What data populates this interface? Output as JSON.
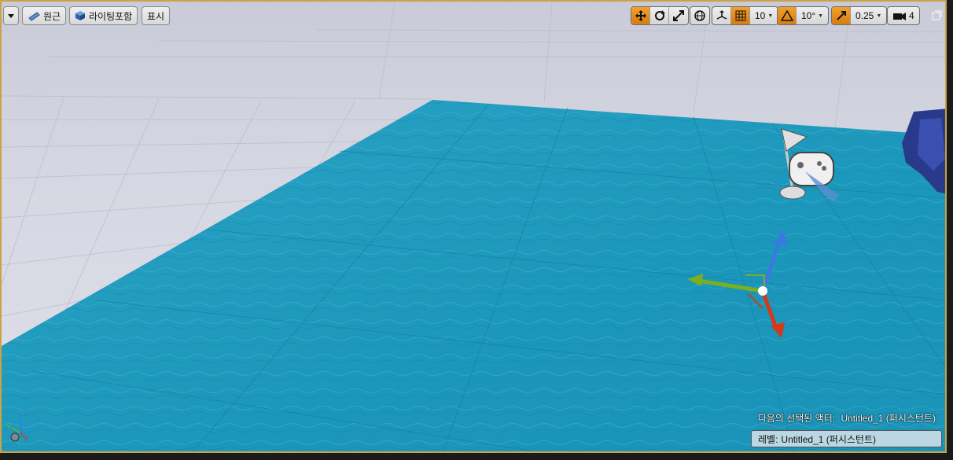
{
  "toolbar": {
    "perspective_label": "원근",
    "lighting_label": "라이팅포함",
    "show_label": "표시",
    "grid_snap_value": "10",
    "rotation_snap_value": "10°",
    "scale_snap_value": "0.25",
    "camera_speed_value": "4"
  },
  "status": {
    "selected_actor_label": "다음의 선택된 액터:",
    "selected_actor_value": "Untitled_1 (퍼시스턴트)",
    "level_label": "레벨:",
    "level_value": "Untitled_1 (퍼시스턴트)"
  },
  "axis_indicator": {
    "z": "Z",
    "y": "Y",
    "x": "X"
  },
  "colors": {
    "accent": "#d67d12",
    "water": "#1f9cbf",
    "border": "#c9a24a",
    "gizmo_x": "#d33a1a",
    "gizmo_y": "#7ab020",
    "gizmo_z": "#3a7ae0"
  },
  "icons": {
    "dropdown": "chevron-down-icon",
    "perspective": "perspective-icon",
    "lighting": "lit-cube-icon",
    "translate": "translate-icon",
    "rotate": "rotate-icon",
    "scale": "scale-icon",
    "coordinate_space": "globe-icon",
    "surface_snap": "surface-snap-icon",
    "grid_snap": "grid-icon",
    "rotation_snap": "angle-icon",
    "scale_snap": "scale-snap-icon",
    "camera_speed": "camera-icon",
    "maximize": "maximize-icon",
    "player_start": "player-start-icon"
  }
}
